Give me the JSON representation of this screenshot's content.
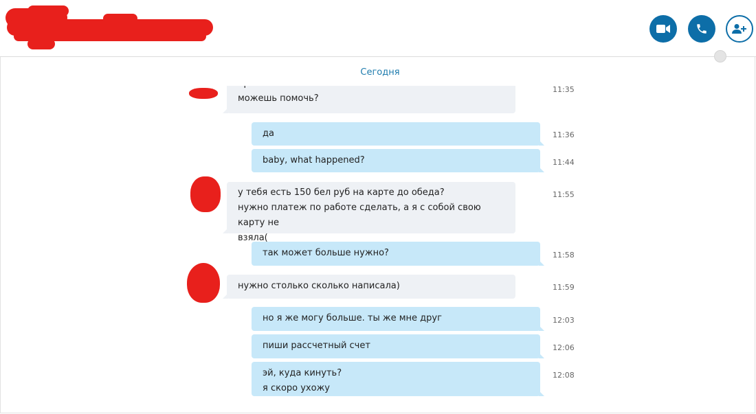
{
  "header": {
    "video_icon": "video-camera-icon",
    "call_icon": "phone-icon",
    "add_icon": "add-person-icon"
  },
  "date_separator": "Сегодня",
  "messages": [
    {
      "side": "in",
      "lines": [
        "привет!",
        "можешь помочь?"
      ],
      "time": "11:35"
    },
    {
      "side": "out",
      "lines": [
        "да"
      ],
      "time": "11:36"
    },
    {
      "side": "out",
      "lines": [
        "baby, what happened?"
      ],
      "time": "11:44"
    },
    {
      "side": "in",
      "lines": [
        "у тебя есть 150 бел руб на карте до обеда?",
        "нужно платеж по работе сделать, а я с собой свою карту не",
        "взяла("
      ],
      "time": "11:55"
    },
    {
      "side": "out",
      "lines": [
        "так может больше нужно?"
      ],
      "time": "11:58"
    },
    {
      "side": "in",
      "lines": [
        "нужно столько сколько написала)"
      ],
      "time": "11:59"
    },
    {
      "side": "out",
      "lines": [
        "но я же могу больше. ты же мне друг"
      ],
      "time": "12:03"
    },
    {
      "side": "out",
      "lines": [
        "пиши рассчетный счет"
      ],
      "time": "12:06"
    },
    {
      "side": "out",
      "lines": [
        "эй, куда кинуть?",
        "я скоро ухожу"
      ],
      "time": "12:08"
    }
  ],
  "colors": {
    "accent": "#0d6ea8",
    "outgoing": "#c7e8f9",
    "incoming": "#eef1f5",
    "redaction": "#e8201c"
  }
}
